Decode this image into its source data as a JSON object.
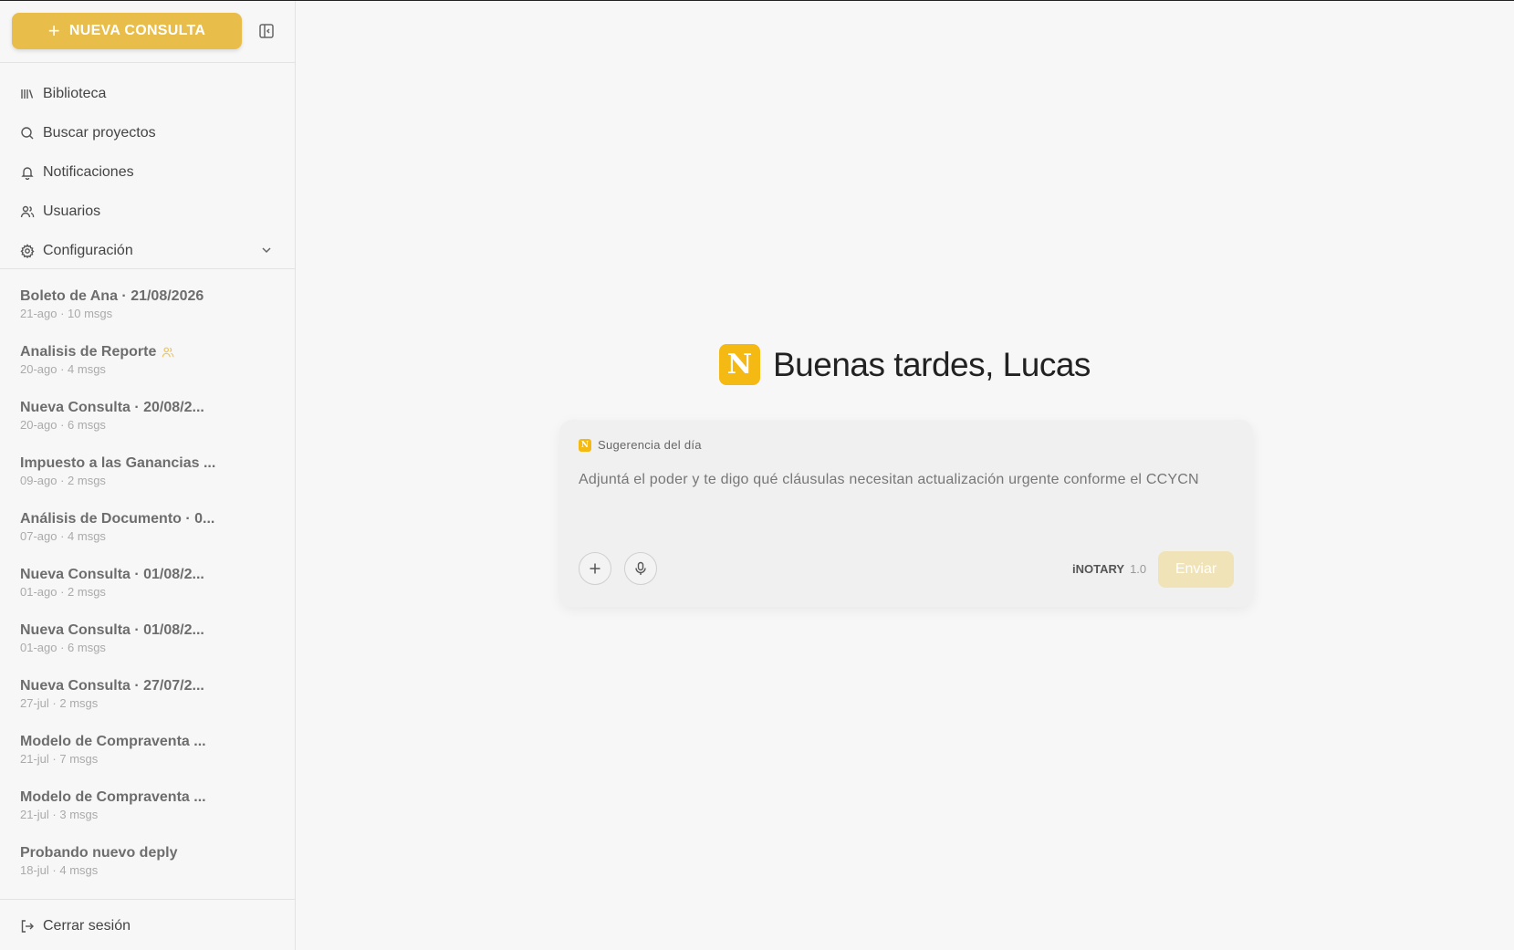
{
  "sidebar": {
    "new_button_label": "NUEVA CONSULTA",
    "nav": [
      {
        "label": "Biblioteca",
        "icon": "library-icon"
      },
      {
        "label": "Buscar proyectos",
        "icon": "search-icon"
      },
      {
        "label": "Notificaciones",
        "icon": "bell-icon"
      },
      {
        "label": "Usuarios",
        "icon": "users-icon"
      },
      {
        "label": "Configuración",
        "icon": "gear-icon"
      }
    ],
    "history": [
      {
        "title": "Boleto de Ana · 21/08/2026",
        "meta": "21-ago · 10 msgs"
      },
      {
        "title": "Analisis de Reporte",
        "meta": "20-ago · 4 msgs",
        "shared": true
      },
      {
        "title": "Nueva Consulta · 20/08/2...",
        "meta": "20-ago · 6 msgs"
      },
      {
        "title": "Impuesto a las Ganancias ...",
        "meta": "09-ago · 2 msgs"
      },
      {
        "title": "Análisis de Documento · 0...",
        "meta": "07-ago · 4 msgs"
      },
      {
        "title": "Nueva Consulta · 01/08/2...",
        "meta": "01-ago · 2 msgs"
      },
      {
        "title": "Nueva Consulta · 01/08/2...",
        "meta": "01-ago · 6 msgs"
      },
      {
        "title": "Nueva Consulta · 27/07/2...",
        "meta": "27-jul · 2 msgs"
      },
      {
        "title": "Modelo de Compraventa ...",
        "meta": "21-jul · 7 msgs"
      },
      {
        "title": "Modelo de Compraventa ...",
        "meta": "21-jul · 3 msgs"
      },
      {
        "title": "Probando nuevo deply",
        "meta": "18-jul · 4 msgs"
      }
    ],
    "logout_label": "Cerrar sesión"
  },
  "main": {
    "logo_letter": "N",
    "greeting": "Buenas tardes, Lucas",
    "card": {
      "suggestion_label": "Sugerencia del día",
      "prompt": "Adjuntá el poder y te digo qué cláusulas necesitan actualización urgente conforme el CCYCN",
      "model_name": "iNOTARY",
      "model_version": "1.0",
      "send_label": "Enviar"
    }
  },
  "colors": {
    "accent": "#e9bd4a",
    "logo": "#f5b914",
    "send_disabled": "#f1e3b8"
  }
}
